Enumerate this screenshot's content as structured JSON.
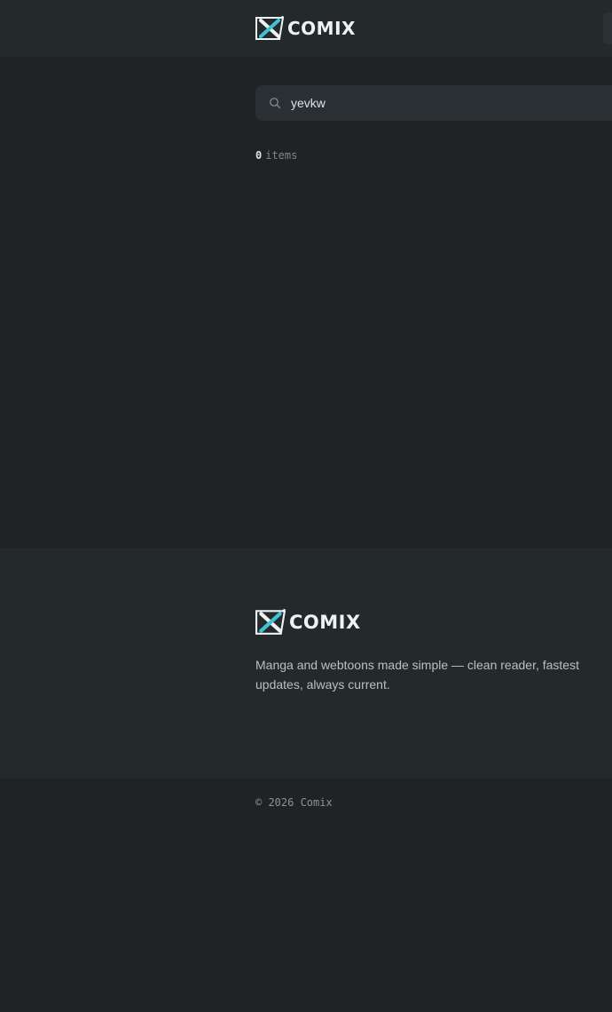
{
  "brand": {
    "name": "COMIX",
    "accent_color": "#3fc1d6"
  },
  "header": {
    "logo_icon": "comix-x-icon"
  },
  "search": {
    "value": "yevkw",
    "icon": "search-icon"
  },
  "results": {
    "count": "0",
    "label": "items"
  },
  "footer": {
    "tagline": "Manga and webtoons made simple — clean reader, fastest updates, always current.",
    "copyright": "© 2026 Comix"
  }
}
